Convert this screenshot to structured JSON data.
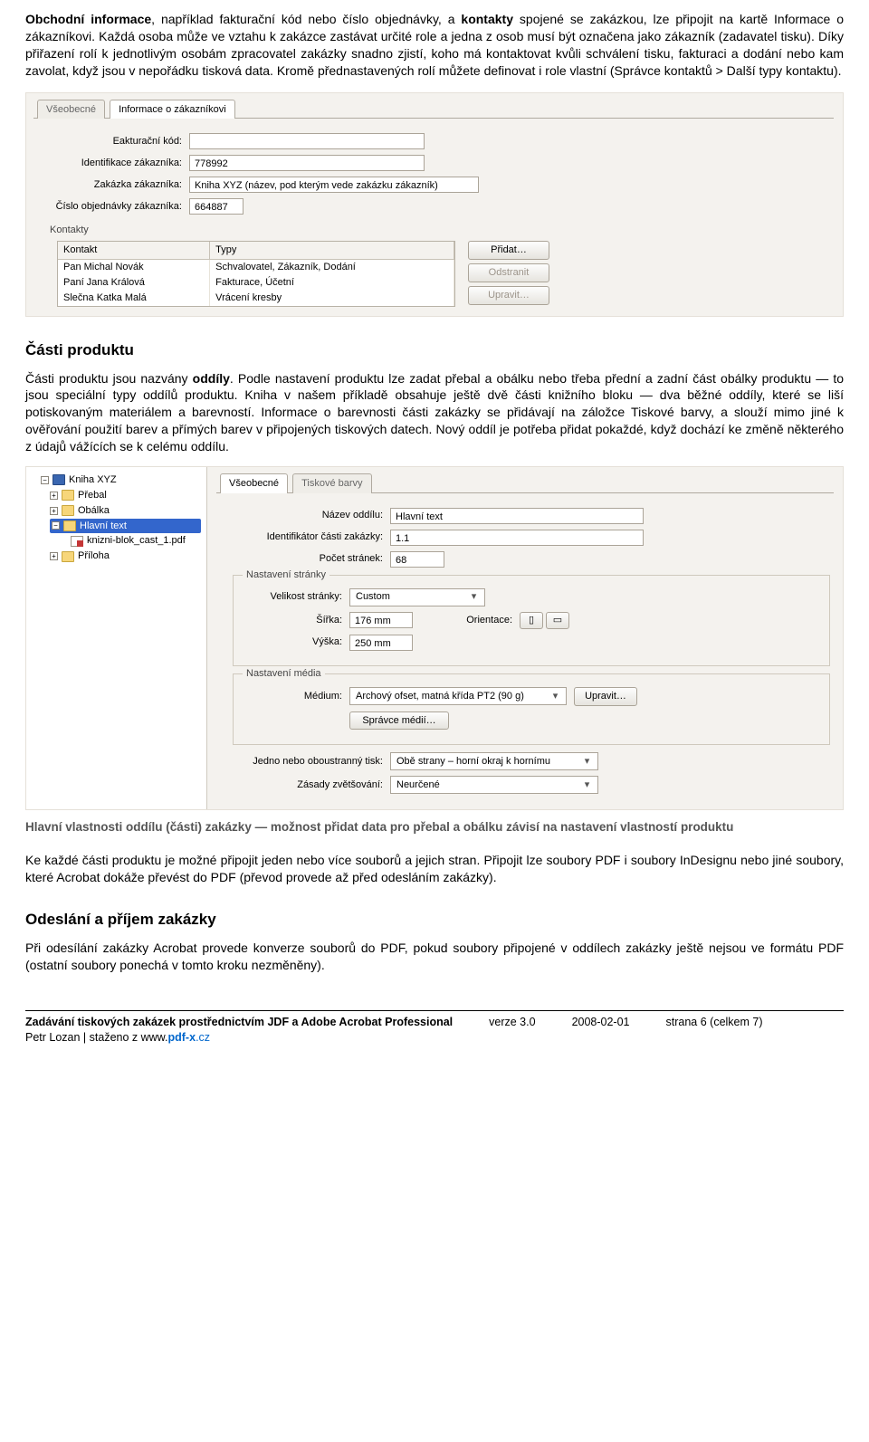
{
  "intro": {
    "p1a": "Obchodní informace",
    "p1b": ", například fakturační kód nebo číslo objednávky, a ",
    "p1c": "kontakty",
    "p1d": " spojené se zakázkou, lze připojit na kartě Informace o zákazníkovi. Každá osoba může ve vztahu k zakázce zastávat určité role a jedna z osob musí být označena jako zákazník (zadavatel tisku). Díky přiřazení rolí k jednotlivým osobám zpracovatel zakázky snadno zjistí, koho má kontaktovat kvůli schválení tisku, fakturaci a dodání nebo kam zavolat, když jsou v nepořádku tisková data. Kromě přednastavených rolí můžete definovat i role vlastní (Správce kontaktů > Další typy kontaktu)."
  },
  "shot1": {
    "tab1": "Všeobecné",
    "tab2": "Informace o zákazníkovi",
    "lbl_billing": "Eakturační kód:",
    "lbl_custid": "Identifikace zákazníka:",
    "val_custid": "778992",
    "lbl_job": "Zakázka zákazníka:",
    "val_job": "Kniha XYZ (název, pod kterým vede zakázku zákazník)",
    "lbl_order": "Číslo objednávky zákazníka:",
    "val_order": "664887",
    "group": "Kontakty",
    "col_contact": "Kontakt",
    "col_types": "Typy",
    "rows": [
      {
        "name": "Pan Michal Novák",
        "types": "Schvalovatel, Zákazník, Dodání"
      },
      {
        "name": "Paní Jana Králová",
        "types": "Fakturace, Účetní"
      },
      {
        "name": "Slečna Katka Malá",
        "types": "Vrácení kresby"
      }
    ],
    "btn_add": "Přidat…",
    "btn_remove": "Odstranit",
    "btn_edit": "Upravit…"
  },
  "parts": {
    "heading": "Části produktu",
    "p_a": "Části produktu jsou nazvány ",
    "p_b": "oddíly",
    "p_c": ". Podle nastavení produktu lze zadat přebal a obálku nebo třeba přední a zadní část obálky produktu — to jsou speciální typy oddílů produktu. Kniha v našem příkladě obsahuje ještě dvě části knižního bloku — dva běžné oddíly, které se liší potiskovaným materiálem a barevností. Informace o barevnosti části zakázky se přidávají na záložce Tiskové barvy, a slouží mimo jiné k ověřování použití barev a přímých barev v připojených tiskových datech. Nový oddíl je potřeba přidat pokaždé, když dochází ke změně některého z údajů vážících se k celému oddílu."
  },
  "shot2": {
    "tree": {
      "root": "Kniha XYZ",
      "n1": "Přebal",
      "n2": "Obálka",
      "n3": "Hlavní text",
      "n3a": "knizni-blok_cast_1.pdf",
      "n4": "Příloha"
    },
    "tab1": "Všeobecné",
    "tab2": "Tiskové barvy",
    "lbl_name": "Název oddílu:",
    "val_name": "Hlavní text",
    "lbl_id": "Identifikátor části zakázky:",
    "val_id": "1.1",
    "lbl_pages": "Počet stránek:",
    "val_pages": "68",
    "grp_page": "Nastavení stránky",
    "lbl_pagesize": "Velikost stránky:",
    "val_pagesize": "Custom",
    "lbl_width": "Šířka:",
    "val_width": "176 mm",
    "lbl_orient": "Orientace:",
    "lbl_height": "Výška:",
    "val_height": "250 mm",
    "grp_media": "Nastavení média",
    "lbl_medium": "Médium:",
    "val_medium": "Archový ofset, matná křída PT2 (90 g)",
    "btn_editmedium": "Upravit…",
    "btn_mediamgr": "Správce médií…",
    "lbl_sides": "Jedno nebo oboustranný tisk:",
    "val_sides": "Obě strany – horní okraj k hornímu",
    "lbl_scale": "Zásady zvětšování:",
    "val_scale": "Neurčené"
  },
  "caption": "Hlavní vlastnosti oddílu (části) zakázky — možnost přidat data pro přebal a obálku závisí na nastavení vlastností produktu",
  "after": {
    "p1": "Ke každé části produktu je možné připojit jeden nebo více souborů a jejich stran. Připojit lze soubory PDF i soubory InDesignu nebo jiné soubory, které Acrobat dokáže převést do PDF (převod provede až před odesláním zakázky).",
    "h": "Odeslání a příjem zakázky",
    "p2": "Při odesílání zakázky Acrobat provede konverze souborů do PDF, pokud soubory připojené v oddílech zakázky ještě nejsou ve formátu PDF (ostatní soubory ponechá v tomto kroku nezměněny)."
  },
  "footer": {
    "title": "Zadávání tiskových zakázek prostřednictvím JDF a Adobe Acrobat Professional",
    "version": "verze 3.0",
    "date": "2008-02-01",
    "page": "strana 6 (celkem 7)",
    "author": "Petr Lozan | staženo z www.",
    "site_a": "pdf-x",
    "site_b": ".cz"
  }
}
